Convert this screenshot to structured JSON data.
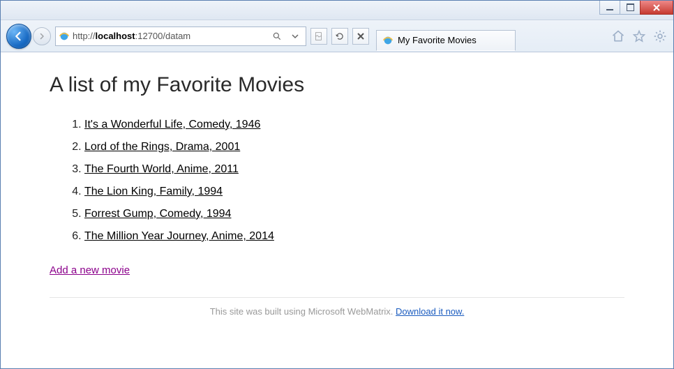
{
  "window": {
    "app": "Internet Explorer"
  },
  "address": {
    "host": "localhost",
    "port": "12700",
    "path": "/datam"
  },
  "tab": {
    "title": "My Favorite Movies"
  },
  "page": {
    "heading": "A list of my Favorite Movies",
    "movies": [
      "It's a Wonderful Life, Comedy, 1946",
      "Lord of the Rings, Drama, 2001",
      "The Fourth World, Anime, 2011",
      "The Lion King, Family, 1994",
      "Forrest Gump, Comedy, 1994",
      "The Million Year Journey, Anime, 2014"
    ],
    "add_link": "Add a new movie",
    "footer_text": "This site was built using Microsoft WebMatrix. ",
    "footer_link": "Download it now."
  }
}
